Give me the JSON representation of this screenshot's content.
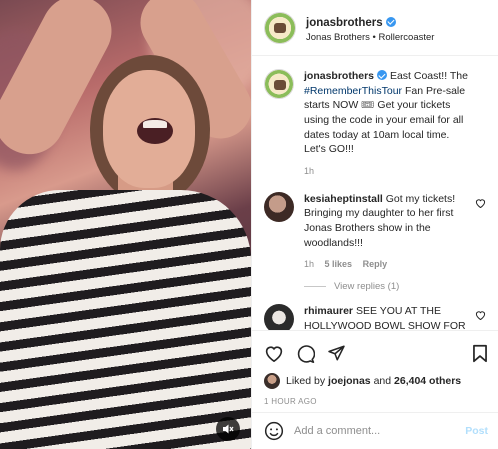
{
  "post": {
    "username": "jonasbrothers",
    "location": "Jonas Brothers • Rollercoaster"
  },
  "caption": {
    "username": "jonasbrothers",
    "text_before": "East Coast!! The",
    "hashtag": "#RememberThisTour",
    "text_after": "Fan Pre-sale starts NOW 🎟 Get your tickets using the code in your email for all dates today at 10am local time. Let's GO!!!",
    "time": "1h"
  },
  "comments": [
    {
      "username": "kesiaheptinstall",
      "text": "Got my tickets! Bringing my daughter to her first Jonas Brothers show in the woodlands!!!",
      "time": "1h",
      "likes": "5 likes",
      "reply": "Reply",
      "view_replies": "View replies (1)"
    },
    {
      "username": "rhimaurer",
      "text": "SEE YOU AT THE HOLLYWOOD BOWL SHOW FOR A LATE BIRTHDAY PRESENT"
    }
  ],
  "likes": {
    "prefix": "Liked by",
    "user": "joejonas",
    "and": "and",
    "count": "26,404 others"
  },
  "timestamp": "1 HOUR AGO",
  "add_comment": {
    "placeholder": "Add a comment...",
    "post_label": "Post"
  },
  "icons": [
    "heart-icon",
    "comment-icon",
    "share-icon",
    "bookmark-icon",
    "emoji-icon",
    "mute-icon"
  ],
  "colors": {
    "link": "#00376b",
    "verified": "#3897f0",
    "muted": "#8e8e8e",
    "post_disabled": "#b2dffc"
  }
}
